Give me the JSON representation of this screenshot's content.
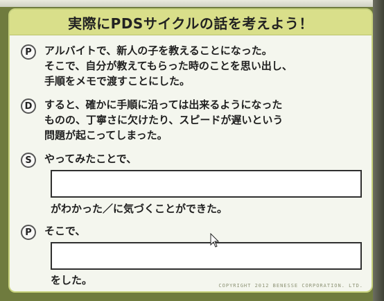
{
  "header": {
    "title": "実際にPDSサイクルの話を考えよう！"
  },
  "rows": [
    {
      "badge": "P",
      "text": "アルバイトで、新人の子を教えることになった。\nそこで、自分が教えてもらった時のことを思い出し、\n手順をメモで渡すことにした。"
    },
    {
      "badge": "D",
      "text": "すると、確かに手順に沿っては出来るようになった\nものの、丁寧さに欠けたり、スピードが遅いという\n問題が起こってしまった。"
    },
    {
      "badge": "S",
      "text": "やってみたことで、",
      "after": "がわかった／に気づくことができた。"
    },
    {
      "badge": "P",
      "text": "そこで、",
      "after": "をした。"
    }
  ],
  "footer": {
    "copyright": "COPYRIGHT 2012 BENESSE CORPORATION. LTD."
  },
  "colors": {
    "header": "#d9df8a",
    "border": "#c7d27b",
    "background": "#f4f6ee"
  },
  "icons": {
    "cursor": "mouse-pointer-icon"
  }
}
